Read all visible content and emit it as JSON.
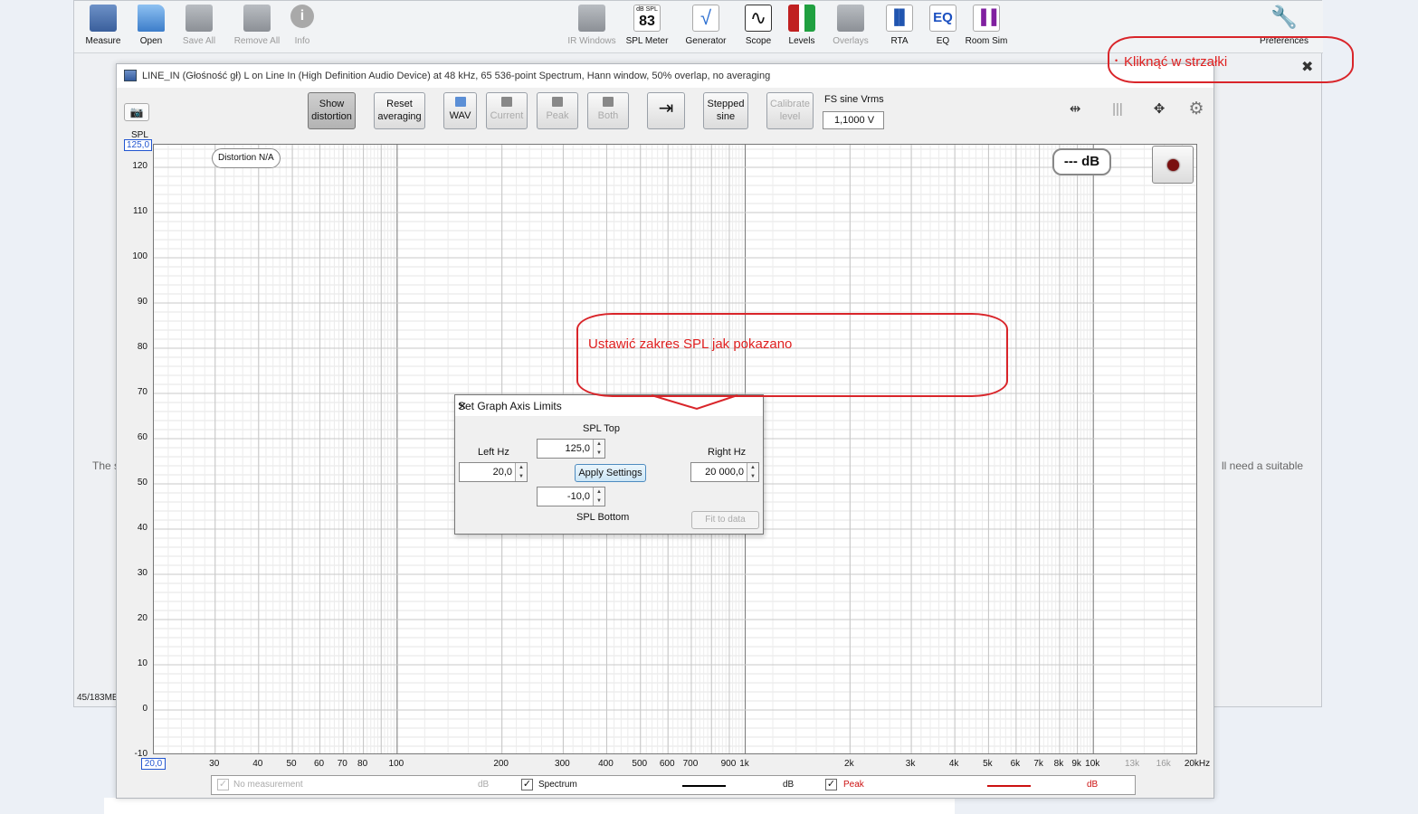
{
  "toolbar": {
    "items": [
      {
        "label": "Measure",
        "icon": "measure-icon",
        "enabled": true
      },
      {
        "label": "Open",
        "icon": "folder-icon",
        "enabled": true
      },
      {
        "label": "Save All",
        "icon": "save-icon",
        "enabled": false
      },
      {
        "label": "Remove All",
        "icon": "remove-icon",
        "enabled": false
      },
      {
        "label": "Info",
        "icon": "info-icon",
        "enabled": false
      },
      {
        "label": "IR Windows",
        "icon": "ir-windows-icon",
        "enabled": false
      },
      {
        "label": "SPL Meter",
        "icon": "spl-meter-icon",
        "enabled": true,
        "readout_unit": "dB SPL",
        "readout_value": "83"
      },
      {
        "label": "Generator",
        "icon": "generator-icon",
        "enabled": true
      },
      {
        "label": "Scope",
        "icon": "scope-icon",
        "enabled": true
      },
      {
        "label": "Levels",
        "icon": "levels-icon",
        "enabled": true
      },
      {
        "label": "Overlays",
        "icon": "overlays-icon",
        "enabled": false
      },
      {
        "label": "RTA",
        "icon": "rta-icon",
        "enabled": true
      },
      {
        "label": "EQ",
        "icon": "eq-icon",
        "enabled": true
      },
      {
        "label": "Room Sim",
        "icon": "room-sim-icon",
        "enabled": true
      },
      {
        "label": "Preferences",
        "icon": "wrench-icon",
        "enabled": true
      }
    ]
  },
  "background": {
    "text_left": "The s",
    "text_right": "ll need a suitable",
    "status": "45/183MB"
  },
  "rta": {
    "title": "LINE_IN (Głośność gł) L on Line In (High Definition Audio Device) at 48 kHz, 65 536-point Spectrum, Hann window, 50% overlap, no averaging",
    "buttons": {
      "show_distortion": "Show distortion",
      "reset_averaging": "Reset averaging",
      "wav": "WAV",
      "current": "Current",
      "peak": "Peak",
      "both": "Both",
      "stepped_sine": "Stepped sine",
      "calibrate_level": "Calibrate level"
    },
    "fs_label": "FS sine Vrms",
    "fs_value": "1,1000 V",
    "distortion_badge": "Distortion N/A",
    "db_readout": "--- dB",
    "spl_axis_title": "SPL",
    "spl_top_box": "125,0",
    "hz_left_box": "20,0"
  },
  "chart_data": {
    "type": "line",
    "title": "",
    "xlabel": "",
    "ylabel": "SPL",
    "x_scale": "log",
    "xlim": [
      20,
      20000
    ],
    "ylim": [
      -10,
      125
    ],
    "y_ticks": [
      120,
      110,
      100,
      90,
      80,
      70,
      60,
      50,
      40,
      30,
      20,
      10,
      0,
      -10
    ],
    "y_tick_labels": [
      "120",
      "110",
      "100",
      "90",
      "80",
      "70",
      "60",
      "50",
      "40",
      "30",
      "20",
      "10",
      "0",
      "-10"
    ],
    "x_ticks": [
      {
        "label": "30",
        "value": 30,
        "dim": false
      },
      {
        "label": "40",
        "value": 40,
        "dim": false
      },
      {
        "label": "50",
        "value": 50,
        "dim": false
      },
      {
        "label": "60",
        "value": 60,
        "dim": false
      },
      {
        "label": "70",
        "value": 70,
        "dim": false
      },
      {
        "label": "80",
        "value": 80,
        "dim": false
      },
      {
        "label": "100",
        "value": 100,
        "dim": false
      },
      {
        "label": "200",
        "value": 200,
        "dim": false
      },
      {
        "label": "300",
        "value": 300,
        "dim": false
      },
      {
        "label": "400",
        "value": 400,
        "dim": false
      },
      {
        "label": "500",
        "value": 500,
        "dim": false
      },
      {
        "label": "600",
        "value": 600,
        "dim": false
      },
      {
        "label": "700",
        "value": 700,
        "dim": false
      },
      {
        "label": "900",
        "value": 900,
        "dim": false
      },
      {
        "label": "1k",
        "value": 1000,
        "dim": false
      },
      {
        "label": "2k",
        "value": 2000,
        "dim": false
      },
      {
        "label": "3k",
        "value": 3000,
        "dim": false
      },
      {
        "label": "4k",
        "value": 4000,
        "dim": false
      },
      {
        "label": "5k",
        "value": 5000,
        "dim": false
      },
      {
        "label": "6k",
        "value": 6000,
        "dim": false
      },
      {
        "label": "7k",
        "value": 7000,
        "dim": false
      },
      {
        "label": "8k",
        "value": 8000,
        "dim": false
      },
      {
        "label": "9k",
        "value": 9000,
        "dim": false
      },
      {
        "label": "10k",
        "value": 10000,
        "dim": false
      },
      {
        "label": "13k",
        "value": 13000,
        "dim": true
      },
      {
        "label": "16k",
        "value": 16000,
        "dim": true
      },
      {
        "label": "20kHz",
        "value": 20000,
        "dim": false
      }
    ],
    "grid": true,
    "series": [],
    "legend": [
      {
        "name": "No measurement",
        "unit": "dB",
        "checked": true,
        "enabled": false
      },
      {
        "name": "Spectrum",
        "unit": "dB",
        "checked": true,
        "enabled": true,
        "color": "#000000"
      },
      {
        "name": "Peak",
        "unit": "dB",
        "checked": true,
        "enabled": true,
        "color": "#cc1111"
      }
    ]
  },
  "dialog": {
    "title": "Set Graph Axis Limits",
    "spl_top_label": "SPL   Top",
    "spl_bottom_label": "SPL   Bottom",
    "left_hz_label": "Left Hz",
    "right_hz_label": "Right Hz",
    "spl_top_value": "125,0",
    "spl_bottom_value": "-10,0",
    "left_hz_value": "20,0",
    "right_hz_value": "20 000,0",
    "apply_label": "Apply Settings",
    "fit_label": "Fit to data"
  },
  "annotations": {
    "top": "Kliknąć w strzałki",
    "middle": "Ustawić zakres SPL jak pokazano",
    "color": "#e02020"
  }
}
